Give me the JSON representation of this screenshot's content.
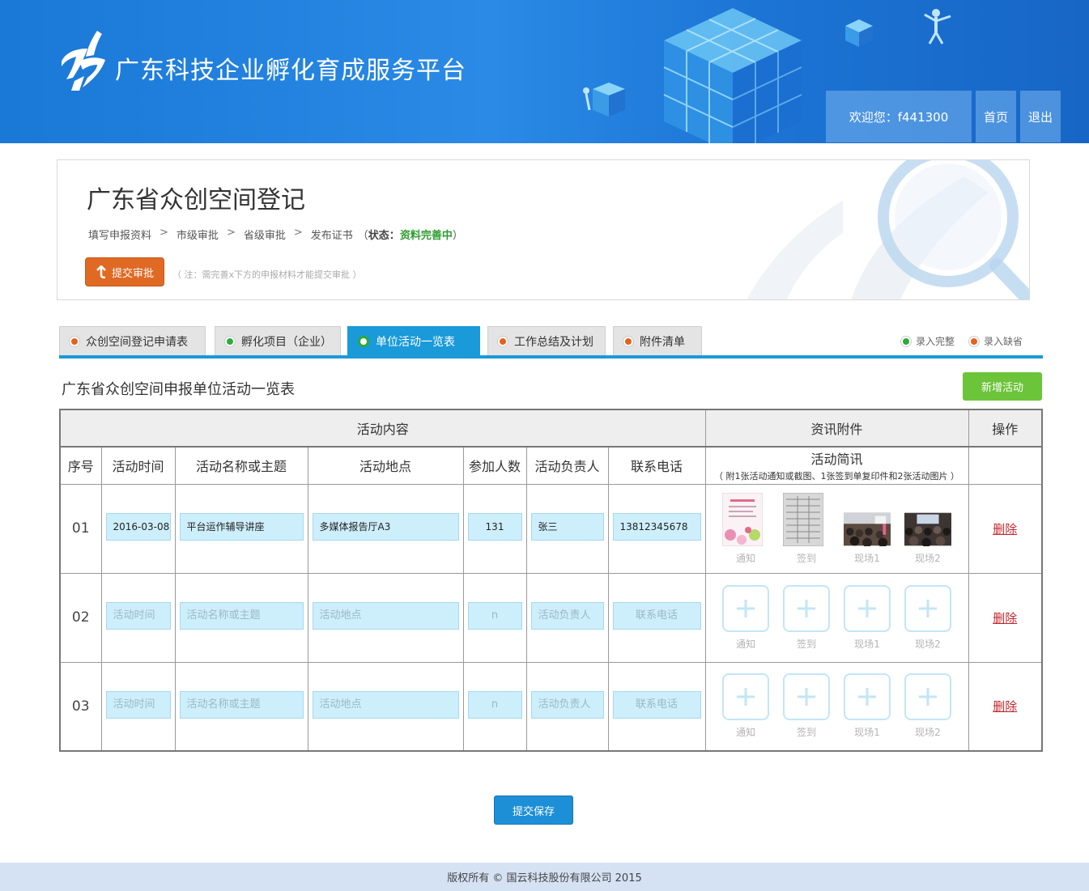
{
  "header": {
    "site_title": "广东科技企业孵化育成服务平台",
    "welcome_text": "欢迎您：f441300",
    "home_label": "首页",
    "logout_label": "退出"
  },
  "registration": {
    "title": "广东省众创空间登记",
    "steps": [
      "填写申报资料",
      "市级审批",
      "省级审批",
      "发布证书"
    ],
    "status_label": "状态：",
    "status_value": "资料完善中",
    "submit_label": "提交审批",
    "note": "（ 注：需完善x下方的申报材料才能提交审批 ）"
  },
  "tabs": [
    {
      "label": "众创空间登记申请表",
      "status": "missing"
    },
    {
      "label": "孵化项目（企业）",
      "status": "complete"
    },
    {
      "label": "单位活动一览表",
      "status": "complete",
      "active": true
    },
    {
      "label": "工作总结及计划",
      "status": "missing"
    },
    {
      "label": "附件清单",
      "status": "missing"
    }
  ],
  "legend": {
    "complete": "录入完整",
    "missing": "录入缺省"
  },
  "colors": {
    "accent": "#1a9ad8",
    "complete": "#2eaa3a",
    "missing": "#e8601c",
    "status_text": "#2f9d2f",
    "add_button": "#6cc43a",
    "delete_link": "#c0282d"
  },
  "section": {
    "title": "广东省众创空间申报单位活动一览表",
    "add_label": "新增活动"
  },
  "table": {
    "group_headers": {
      "content": "活动内容",
      "attachments": "资讯附件",
      "ops": "操作"
    },
    "columns": [
      "序号",
      "活动时间",
      "活动名称或主题",
      "活动地点",
      "参加人数",
      "活动负责人",
      "联系电话"
    ],
    "attach_title": "活动简讯",
    "attach_sub": "（ 附1张活动通知或截图、1张签到单复印件和2张活动图片 ）",
    "attach_labels": [
      "通知",
      "签到",
      "现场1",
      "现场2"
    ],
    "placeholders": {
      "time": "活动时间",
      "name": "活动名称或主题",
      "place": "活动地点",
      "count": "n",
      "leader": "活动负责人",
      "phone": "联系电话"
    },
    "delete_label": "删除",
    "rows": [
      {
        "seq": "01",
        "time": "2016-03-08",
        "name": "平台运作辅导讲座",
        "place": "多媒体报告厅A3",
        "count": "131",
        "leader": "张三",
        "phone": "13812345678"
      },
      {
        "seq": "02"
      },
      {
        "seq": "03"
      }
    ]
  },
  "save_label": "提交保存",
  "footer": "版权所有 © 国云科技股份有限公司 2015"
}
